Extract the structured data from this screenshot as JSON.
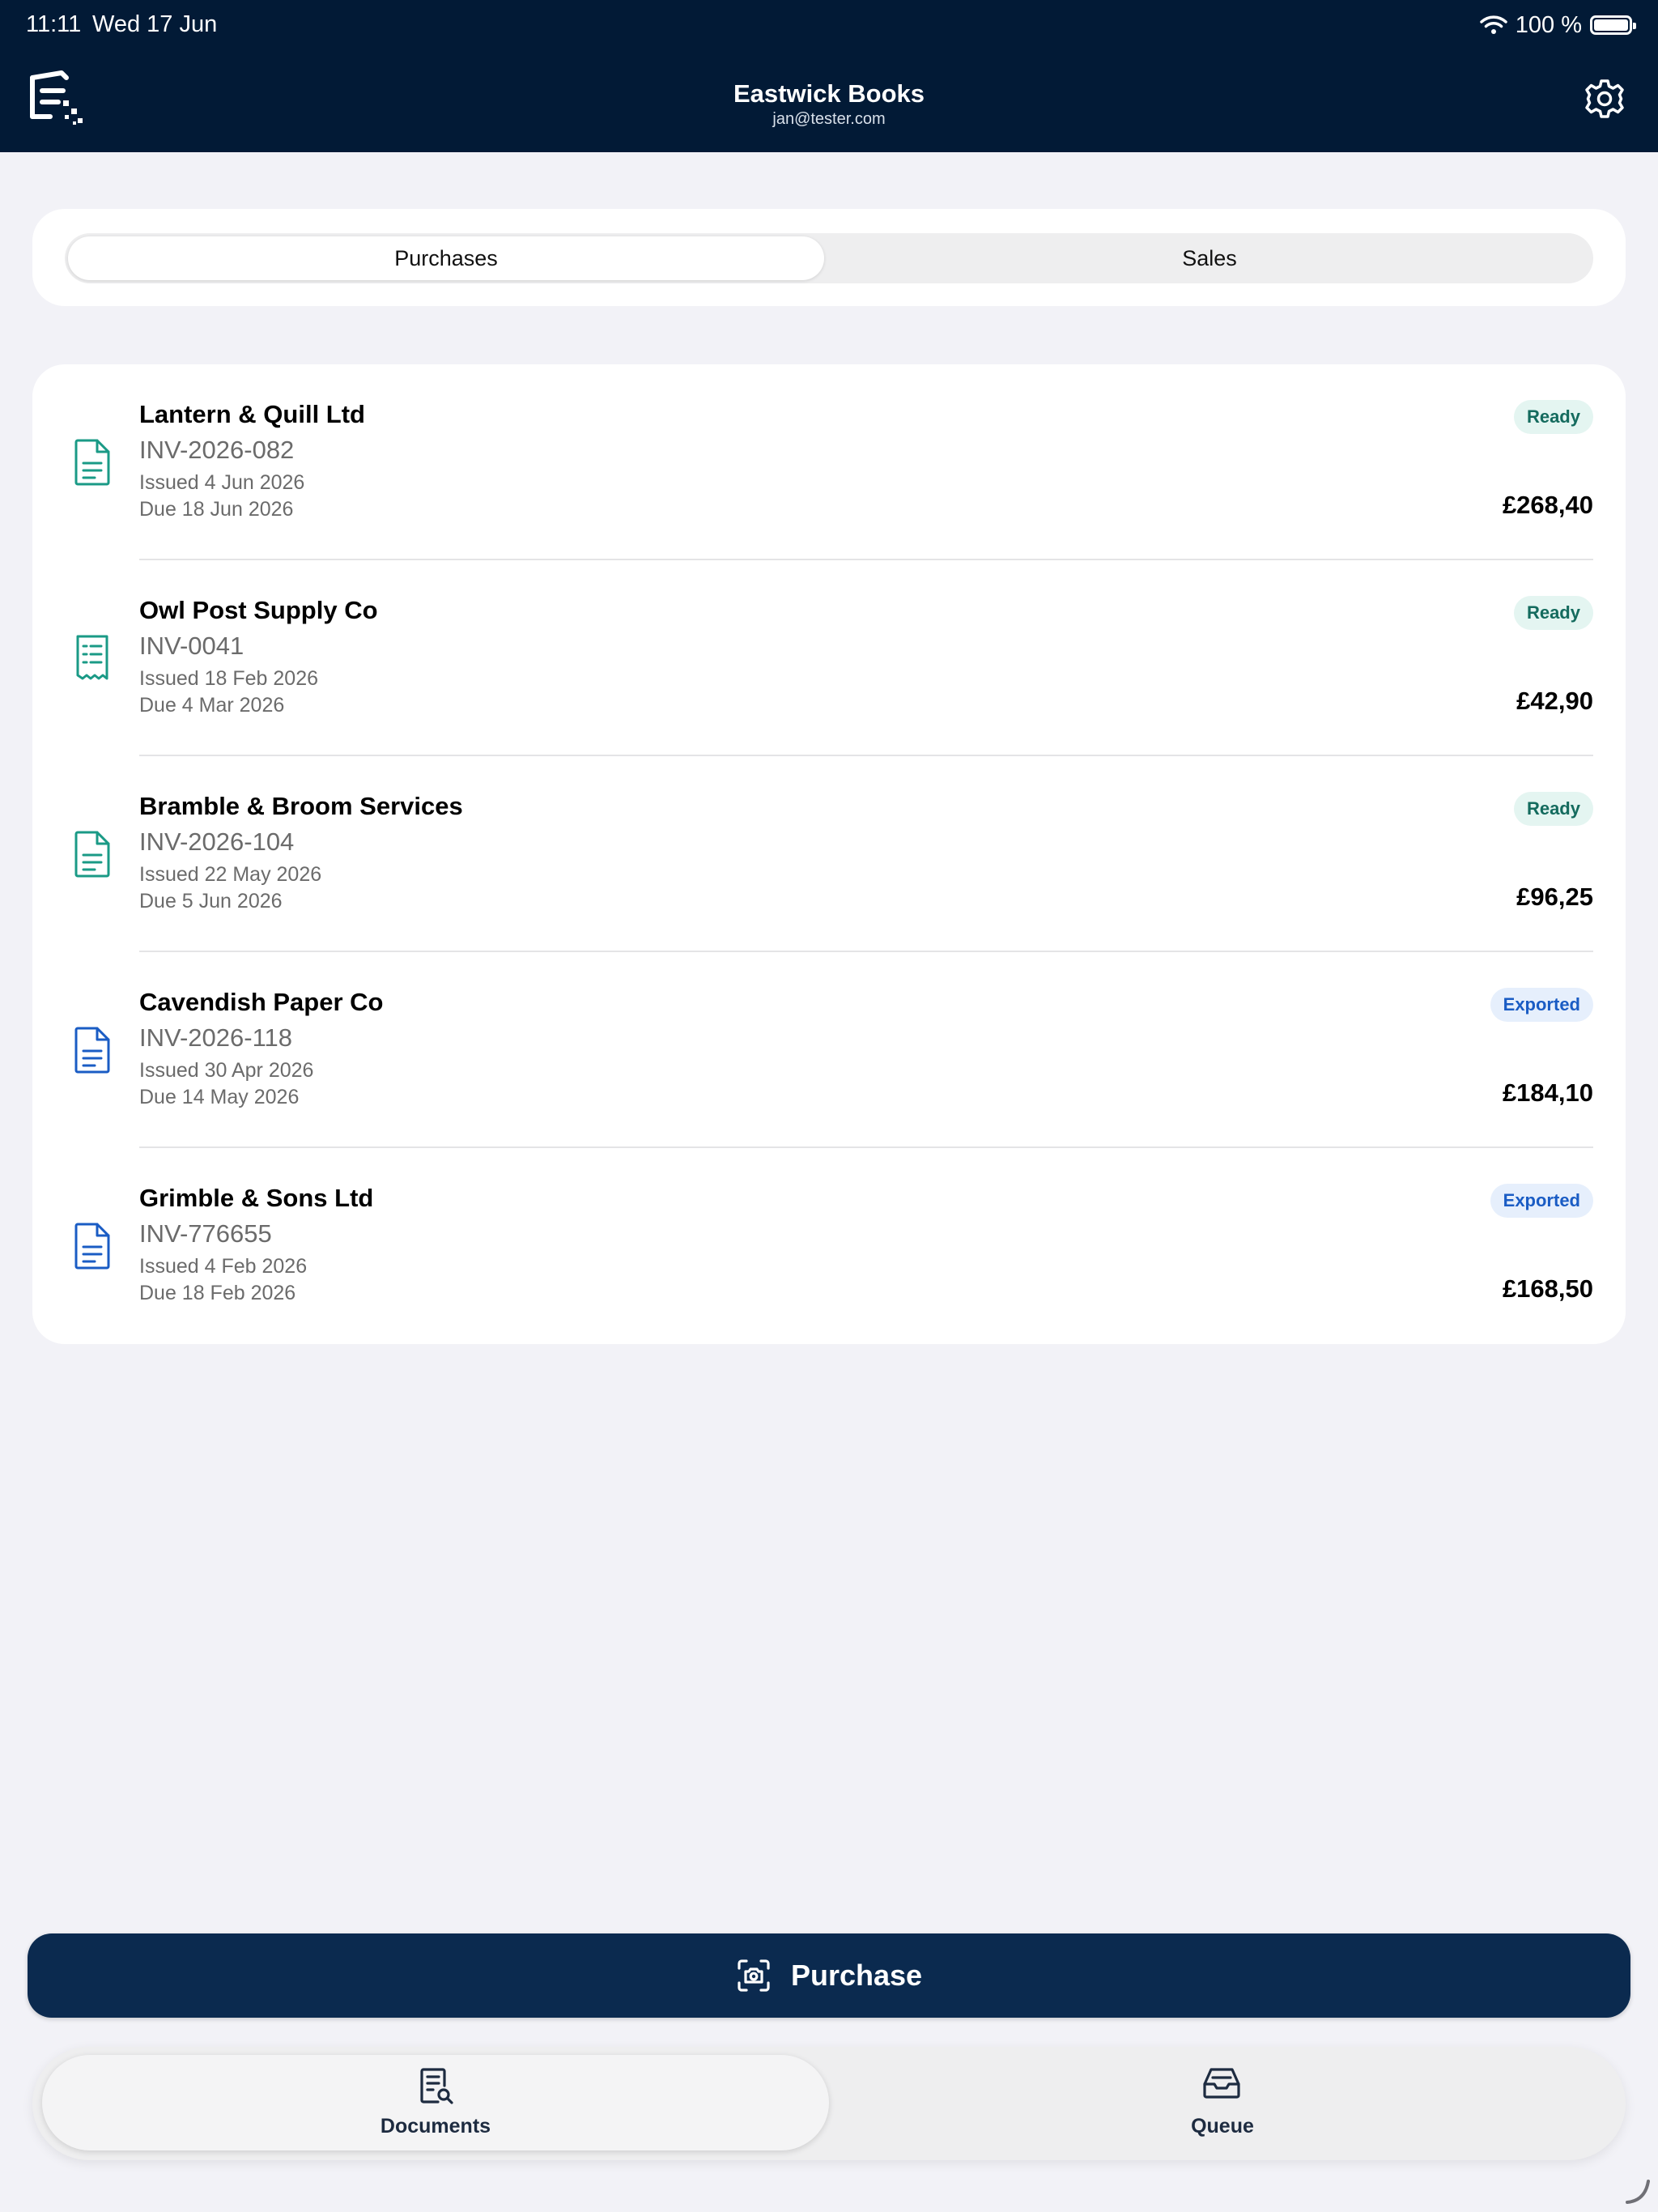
{
  "status_bar": {
    "time": "11:11",
    "date": "Wed 17 Jun",
    "battery": "100 %"
  },
  "header": {
    "title": "Eastwick Books",
    "subtitle": "jan@tester.com"
  },
  "segments": {
    "active": "Purchases",
    "inactive": "Sales"
  },
  "documents": [
    {
      "vendor": "Lantern & Quill Ltd",
      "invoice": "INV-2026-082",
      "issued": "Issued 4 Jun 2026",
      "due": "Due 18 Jun 2026",
      "status": "Ready",
      "amount": "£268,40",
      "icon": "document-icon"
    },
    {
      "vendor": "Owl Post Supply Co",
      "invoice": "INV-0041",
      "issued": "Issued 18 Feb 2026",
      "due": "Due 4 Mar 2026",
      "status": "Ready",
      "amount": "£42,90",
      "icon": "receipt-icon"
    },
    {
      "vendor": "Bramble & Broom Services",
      "invoice": "INV-2026-104",
      "issued": "Issued 22 May 2026",
      "due": "Due 5 Jun 2026",
      "status": "Ready",
      "amount": "£96,25",
      "icon": "document-icon"
    },
    {
      "vendor": "Cavendish Paper Co",
      "invoice": "INV-2026-118",
      "issued": "Issued 30 Apr 2026",
      "due": "Due 14 May 2026",
      "status": "Exported",
      "amount": "£184,10",
      "icon": "document-icon"
    },
    {
      "vendor": "Grimble & Sons Ltd",
      "invoice": "INV-776655",
      "issued": "Issued 4 Feb 2026",
      "due": "Due 18 Feb 2026",
      "status": "Exported",
      "amount": "£168,50",
      "icon": "document-icon"
    }
  ],
  "action": {
    "label": "Purchase",
    "icon": "camera-scan-icon"
  },
  "tabs": [
    {
      "label": "Documents",
      "icon": "document-search-icon"
    },
    {
      "label": "Queue",
      "icon": "inbox-tray-icon"
    }
  ],
  "colors": {
    "header_bg": "#021a36",
    "ready_icon": "#1a9a86",
    "exported_icon": "#1a5cc4",
    "button_bg": "#0b2a4f"
  }
}
